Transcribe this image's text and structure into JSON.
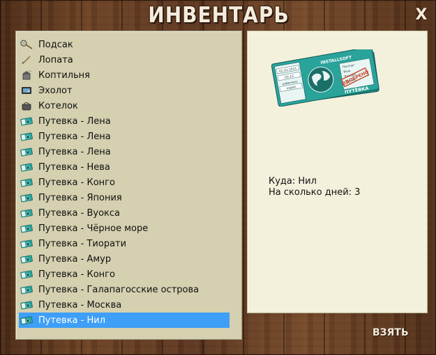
{
  "window": {
    "title": "ИНВЕНТАРЬ",
    "close_label": "X"
  },
  "inventory": {
    "items": [
      {
        "label": "Подсак",
        "icon": "net-icon"
      },
      {
        "label": "Лопата",
        "icon": "shovel-icon"
      },
      {
        "label": "Коптильня",
        "icon": "smokehouse-icon"
      },
      {
        "label": "Эхолот",
        "icon": "sonar-icon"
      },
      {
        "label": "Котелок",
        "icon": "pot-icon"
      },
      {
        "label": "Путевка - Лена",
        "icon": "voucher-icon"
      },
      {
        "label": "Путевка - Лена",
        "icon": "voucher-icon"
      },
      {
        "label": "Путевка - Лена",
        "icon": "voucher-icon"
      },
      {
        "label": "Путевка - Нева",
        "icon": "voucher-icon"
      },
      {
        "label": "Путевка - Конго",
        "icon": "voucher-icon"
      },
      {
        "label": "Путевка - Япония",
        "icon": "voucher-icon"
      },
      {
        "label": "Путевка - Вуокса",
        "icon": "voucher-icon"
      },
      {
        "label": "Путевка - Чёрное море",
        "icon": "voucher-icon"
      },
      {
        "label": "Путевка - Тиорати",
        "icon": "voucher-icon"
      },
      {
        "label": "Путевка - Амур",
        "icon": "voucher-icon"
      },
      {
        "label": "Путевка - Конго",
        "icon": "voucher-icon"
      },
      {
        "label": "Путевка - Галапагосские острова",
        "icon": "voucher-icon"
      },
      {
        "label": "Путевка - Москва",
        "icon": "voucher-icon"
      },
      {
        "label": "Путевка - Нил",
        "icon": "voucher-icon"
      }
    ],
    "selected_index": 18
  },
  "detail": {
    "destination": "Куда: Нил",
    "days": "На сколько дней: 3",
    "ticket": {
      "brand": "INSTALLSOFT",
      "date": "01.01.2011",
      "time": "03:23",
      "added_label": "добавлено:",
      "added_value": "install",
      "stamp": "ОДОБРЕНО",
      "label": "ПУТЁВКА",
      "fields": [
        "Паспорт",
        "Виза",
        "Паспорт",
        "Удочки"
      ]
    }
  },
  "actions": {
    "take_label": "ВЗЯТЬ"
  },
  "colors": {
    "selection": "#3d9ff7",
    "list_bg": "#d4d0b0",
    "detail_bg": "#f3f0dc",
    "ticket_teal": "#1e8a83"
  }
}
